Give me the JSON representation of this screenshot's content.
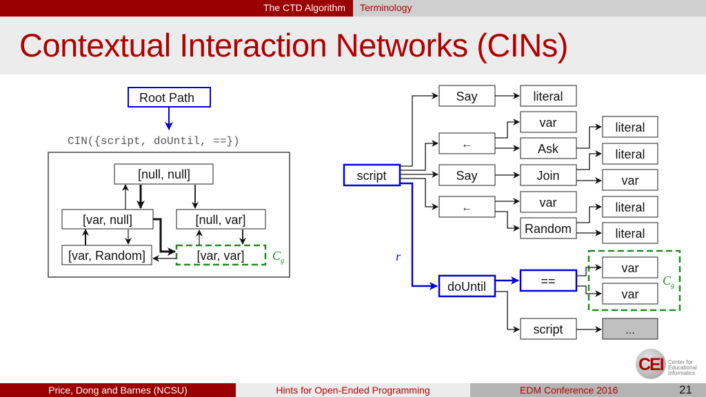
{
  "header": {
    "section_active": "The CTD Algorithm",
    "section_current": "Terminology"
  },
  "title": "Contextual Interaction Networks (CINs)",
  "left_diagram": {
    "root_path_label": "Root Path",
    "cin_expression": "CIN({script, doUntil, ==})",
    "nodes": {
      "null_null": "[null, null]",
      "var_null": "[var, null]",
      "null_var": "[null, var]",
      "var_random": "[var, Random]",
      "var_var": "[var, var]"
    },
    "goal_label": "C",
    "goal_subscript": "g"
  },
  "right_diagram": {
    "root": "script",
    "children": {
      "say1": "Say",
      "literal1": "literal",
      "assign1": "←",
      "var1": "var",
      "ask": "Ask",
      "literal_ask": "literal",
      "say2": "Say",
      "join": "Join",
      "literal_join": "literal",
      "var_join": "var",
      "assign2": "←",
      "var2": "var",
      "random": "Random",
      "literal_r1": "literal",
      "literal_r2": "literal",
      "dountil": "doUntil",
      "eq": "==",
      "var_eq1": "var",
      "var_eq2": "var",
      "script2": "script",
      "ellipsis": "..."
    },
    "root_path_letter": "r",
    "goal_label": "C",
    "goal_subscript": "g"
  },
  "colors": {
    "accent_red": "#9b0000",
    "path_blue": "#0000dd",
    "goal_green": "#1f8a1f",
    "collapsed_gray": "#c0c0c0"
  },
  "footer": {
    "authors": "Price, Dong and Barnes (NCSU)",
    "talk_title": "Hints for Open-Ended Programming",
    "conference": "EDM Conference 2016",
    "page_number": "21",
    "logo": {
      "abbr": "CEI",
      "line1": "Center for",
      "line2": "Educational",
      "line3": "Informatics"
    }
  }
}
